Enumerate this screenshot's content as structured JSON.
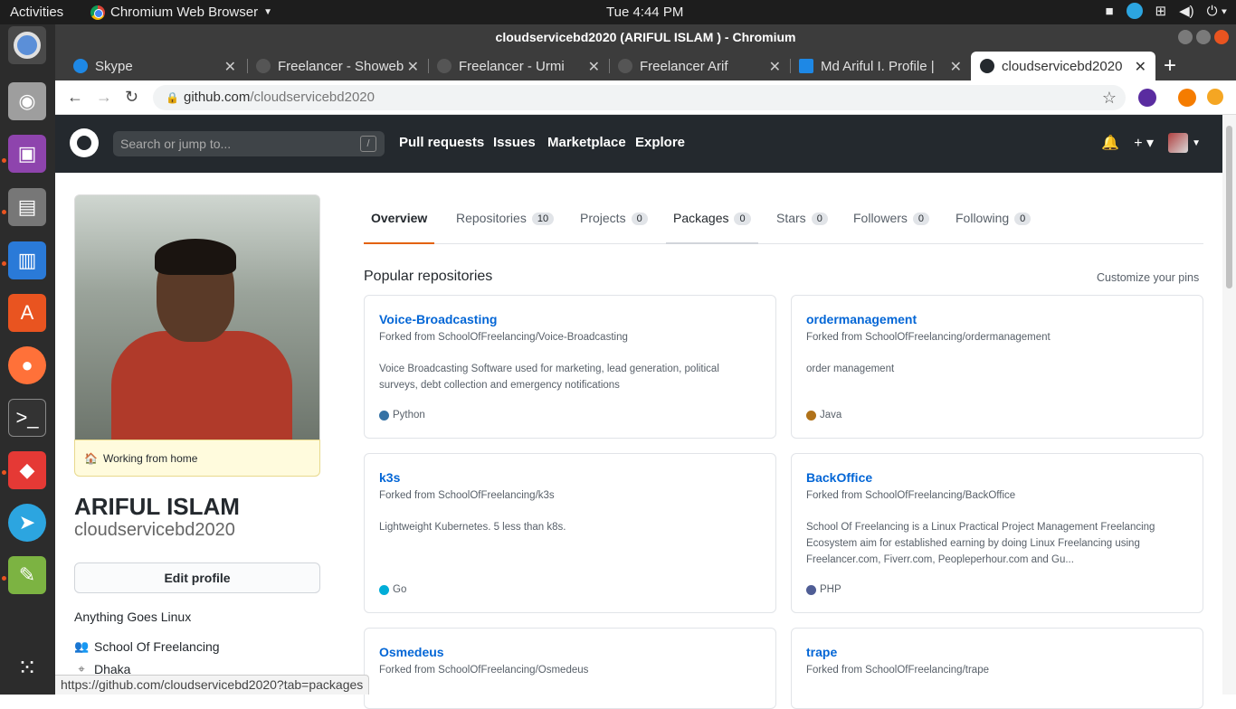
{
  "topbar": {
    "activities": "Activities",
    "app_name": "Chromium Web Browser",
    "clock": "Tue  4:44 PM"
  },
  "window": {
    "title": "cloudservicebd2020 (ARIFUL ISLAM ) - Chromium"
  },
  "tabs": [
    {
      "label": "Skype",
      "icon_color": "#1e88e5"
    },
    {
      "label": "Freelancer - Showeb",
      "icon_color": "#555555"
    },
    {
      "label": "Freelancer - Urmi",
      "icon_color": "#555555"
    },
    {
      "label": "Freelancer Arif",
      "icon_color": "#555555"
    },
    {
      "label": "Md Ariful I. Profile |",
      "icon_color": "#1e88e5"
    },
    {
      "label": "cloudservicebd2020",
      "icon_color": "#24292e"
    }
  ],
  "omnibox": {
    "domain": "github.com",
    "path": "/cloudservicebd2020"
  },
  "github": {
    "search_placeholder": "Search or jump to...",
    "search_shortcut": "/",
    "nav": [
      "Pull requests",
      "Issues",
      "Marketplace",
      "Explore"
    ]
  },
  "profile": {
    "status": "Working from home",
    "status_emoji": "🏠",
    "full_name": "ARIFUL ISLAM",
    "username": "cloudservicebd2020",
    "edit_label": "Edit profile",
    "bio": "Anything Goes Linux",
    "organization": "School Of Freelancing",
    "location": "Dhaka"
  },
  "profile_tabs": [
    {
      "label": "Overview",
      "count": ""
    },
    {
      "label": "Repositories",
      "count": "10"
    },
    {
      "label": "Projects",
      "count": "0"
    },
    {
      "label": "Packages",
      "count": "0"
    },
    {
      "label": "Stars",
      "count": "0"
    },
    {
      "label": "Followers",
      "count": "0"
    },
    {
      "label": "Following",
      "count": "0"
    }
  ],
  "popular": {
    "heading": "Popular repositories",
    "customize": "Customize your pins",
    "repos": [
      {
        "name": "Voice-Broadcasting",
        "fork": "Forked from SchoolOfFreelancing/Voice-Broadcasting",
        "desc": "Voice Broadcasting Software used for marketing, lead generation, political surveys, debt collection and emergency notifications",
        "lang": "Python",
        "lang_color": "#3572A5"
      },
      {
        "name": "ordermanagement",
        "fork": "Forked from SchoolOfFreelancing/ordermanagement",
        "desc": "order management",
        "lang": "Java",
        "lang_color": "#b07219"
      },
      {
        "name": "k3s",
        "fork": "Forked from SchoolOfFreelancing/k3s",
        "desc": "Lightweight Kubernetes. 5 less than k8s.",
        "lang": "Go",
        "lang_color": "#00ADD8"
      },
      {
        "name": "BackOffice",
        "fork": "Forked from SchoolOfFreelancing/BackOffice",
        "desc": "School Of Freelancing is a Linux Practical Project Management Freelancing Ecosystem aim for established earning by doing Linux Freelancing using Freelancer.com, Fiverr.com, Peopleperhour.com and Gu...",
        "lang": "PHP",
        "lang_color": "#4F5D95"
      },
      {
        "name": "Osmedeus",
        "fork": "Forked from SchoolOfFreelancing/Osmedeus",
        "desc": "",
        "lang": "",
        "lang_color": ""
      },
      {
        "name": "trape",
        "fork": "Forked from SchoolOfFreelancing/trape",
        "desc": "",
        "lang": "",
        "lang_color": ""
      }
    ]
  },
  "status_url": "https://github.com/cloudservicebd2020?tab=packages"
}
